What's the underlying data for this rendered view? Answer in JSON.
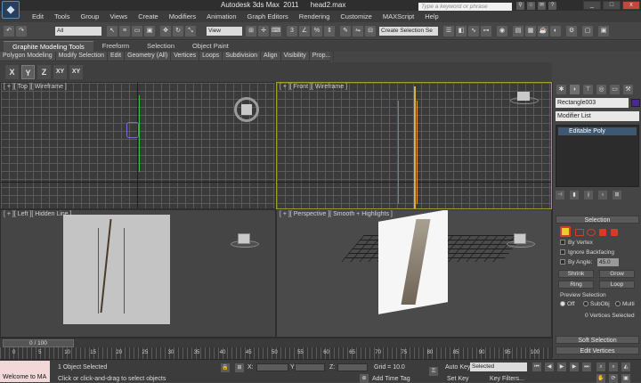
{
  "titlebar": {
    "title": "Autodesk 3ds Max  2011      head2.max",
    "search_placeholder": "Type a keyword or phrase",
    "logo": "3ds-max-logo",
    "window_controls": [
      "_",
      "□",
      "x"
    ]
  },
  "menu": [
    "Edit",
    "Tools",
    "Group",
    "Views",
    "Create",
    "Modifiers",
    "Animation",
    "Graph Editors",
    "Rendering",
    "Customize",
    "MAXScript",
    "Help"
  ],
  "toolbar": {
    "selection_filter": "All",
    "ref_coord": "View",
    "named_selection": "Create Selection Se"
  },
  "ribbon": {
    "tabs": [
      "Graphite Modeling Tools",
      "Freeform",
      "Selection",
      "Object Paint"
    ],
    "items": [
      "Polygon Modeling",
      "Modify Selection",
      "Edit",
      "Geometry (All)",
      "Vertices",
      "Loops",
      "Subdivision",
      "Align",
      "Visibility",
      "Prop..."
    ]
  },
  "axis_constraints": [
    "X",
    "Y",
    "Z",
    "XY",
    "XY"
  ],
  "viewports": {
    "top": "[ + ][ Top ][ Wireframe ]",
    "front": "[ + ][ Front ][ Wireframe ]",
    "left": "[ + ][ Left ][ Hidden Line ]",
    "perspective": "[ + ][ Perspective ][ Smooth + Highlights ]"
  },
  "command_panel": {
    "object_name": "Rectangle003",
    "object_color": "#4a2a8a",
    "modifier_list": "Modifier List",
    "stack_items": [
      "Editable Poly"
    ],
    "selection": {
      "title": "Selection",
      "by_vertex": "By Vertex",
      "ignore_backfacing": "Ignore Backfacing",
      "by_angle": "By Angle:",
      "angle_value": "45.0",
      "shrink": "Shrink",
      "grow": "Grow",
      "ring": "Ring",
      "loop": "Loop",
      "preview_title": "Preview Selection",
      "preview_off": "Off",
      "preview_subobj": "SubObj",
      "preview_multi": "Multi",
      "status": "0 Vertices Selected"
    },
    "soft_selection": "Soft Selection",
    "edit_vertices": "Edit Vertices"
  },
  "timeline": {
    "frame": "0 / 100",
    "ticks": [
      "0",
      "5",
      "10",
      "15",
      "20",
      "25",
      "30",
      "35",
      "40",
      "45",
      "50",
      "55",
      "60",
      "65",
      "70",
      "75",
      "80",
      "85",
      "90",
      "95",
      "100"
    ]
  },
  "status": {
    "maxscript": "Welcome to MA",
    "selected": "1 Object Selected",
    "prompt": "Click or click-and-drag to select objects",
    "x_label": "X:",
    "y_label": "Y:",
    "z_label": "Z:",
    "grid": "Grid = 10.0",
    "add_time_tag": "Add Time Tag",
    "auto_key": "Auto Key",
    "set_key": "Set Key",
    "key_mode": "Selected",
    "key_filters": "Key Filters..."
  }
}
